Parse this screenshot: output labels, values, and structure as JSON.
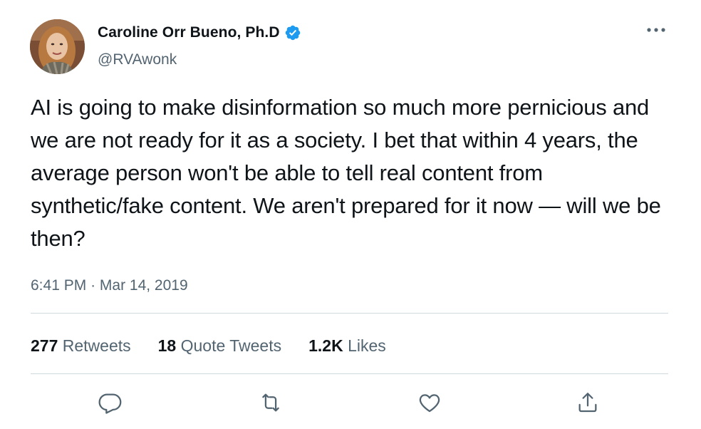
{
  "author": {
    "display_name": "Caroline Orr Bueno, Ph.D",
    "handle": "@RVAwonk",
    "verified": true
  },
  "tweet": {
    "text": "AI is going to make disinformation so much more pernicious and we are not ready for it as a society. I bet that within 4 years, the average person won't be able to tell real content from synthetic/fake content. We aren't prepared for it now — will we be then?",
    "time": "6:41 PM",
    "separator": "·",
    "date": "Mar 14, 2019"
  },
  "stats": {
    "retweets": {
      "count": "277",
      "label": "Retweets"
    },
    "quotes": {
      "count": "18",
      "label": "Quote Tweets"
    },
    "likes": {
      "count": "1.2K",
      "label": "Likes"
    }
  },
  "actions": [
    "reply-icon",
    "retweet-icon",
    "like-icon",
    "share-icon"
  ],
  "colors": {
    "text": "#0f1419",
    "secondary": "#536471",
    "verified": "#1d9bf0",
    "divider": "#cfd9de"
  }
}
